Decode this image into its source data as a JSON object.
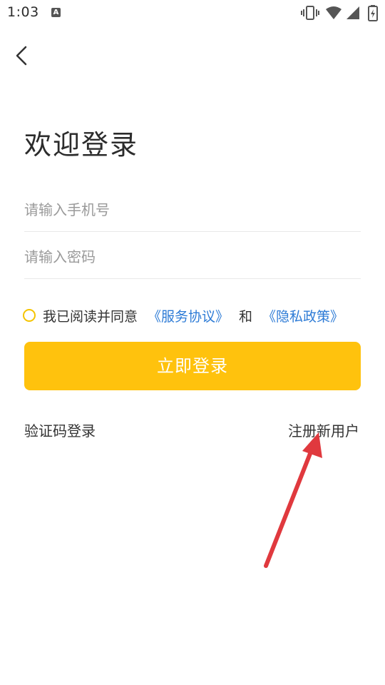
{
  "status_bar": {
    "time": "1:03",
    "notification_icon": "A",
    "icons": [
      "vibrate-icon",
      "wifi-icon",
      "signal-icon",
      "battery-icon"
    ]
  },
  "header": {
    "back_icon": "chevron-left-icon"
  },
  "title": "欢迎登录",
  "form": {
    "phone_placeholder": "请输入手机号",
    "phone_value": "",
    "password_placeholder": "请输入密码",
    "password_value": ""
  },
  "agreement": {
    "checked": false,
    "text": "我已阅读并同意",
    "service_link": "《服务协议》",
    "and_text": "和",
    "privacy_link": "《隐私政策》"
  },
  "login_button_label": "立即登录",
  "links": {
    "sms_login": "验证码登录",
    "register": "注册新用户"
  },
  "colors": {
    "accent": "#ffc20d",
    "link": "#2d7bd6",
    "annotation_arrow": "#e0393e"
  }
}
